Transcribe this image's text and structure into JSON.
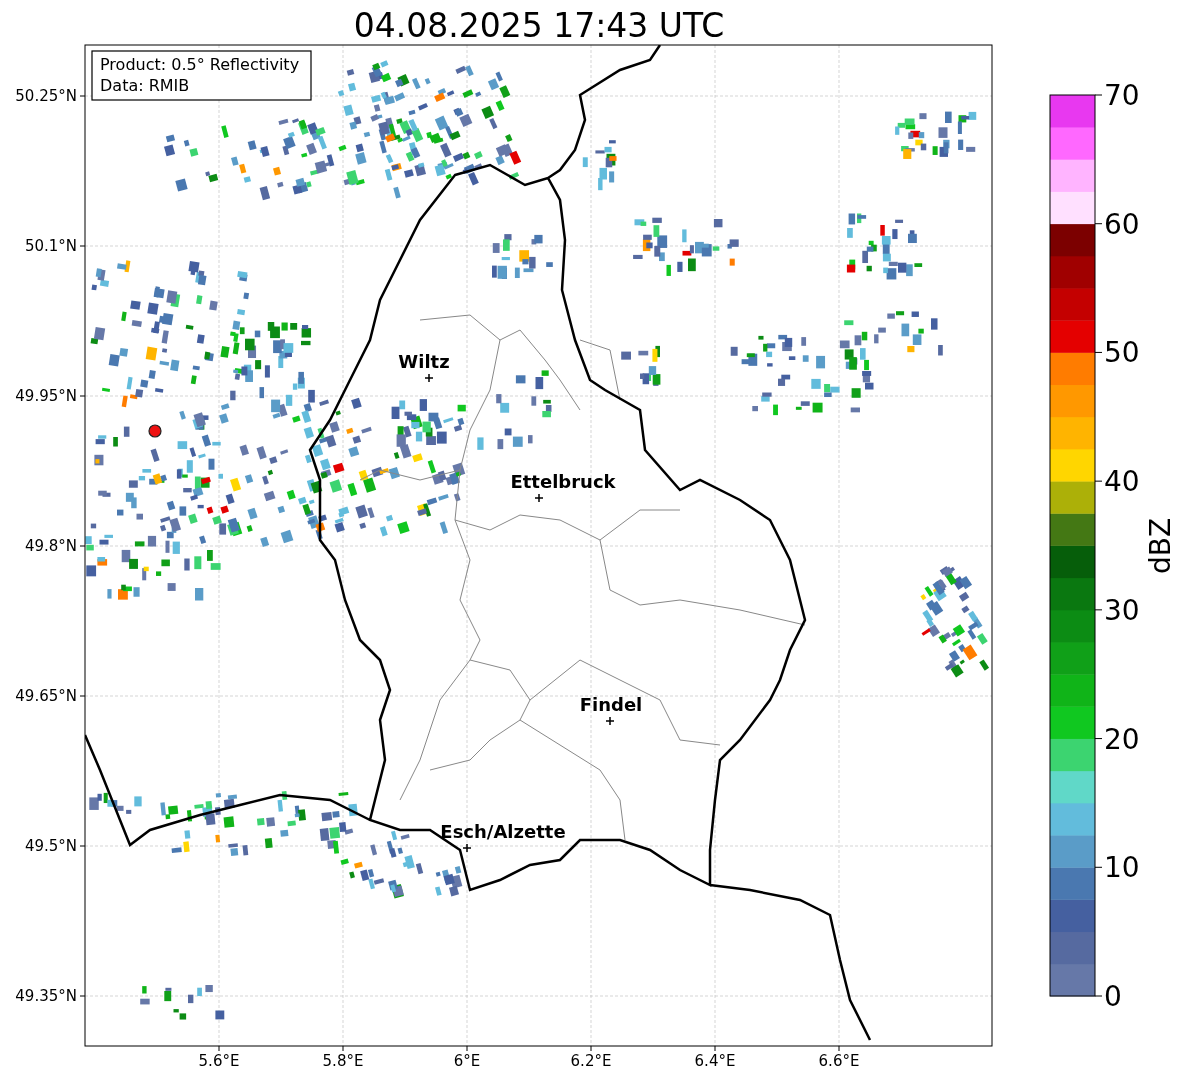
{
  "title": "04.08.2025 17:43 UTC",
  "info_box": {
    "lines": [
      "Product: 0.5° Reflectivity",
      "Data: RMIB"
    ]
  },
  "map": {
    "lat_ticks": [
      "50.25°N",
      "50.1°N",
      "49.95°N",
      "49.8°N",
      "49.65°N",
      "49.5°N",
      "49.35°N"
    ],
    "lon_ticks": [
      "5.6°E",
      "5.8°E",
      "6°E",
      "6.2°E",
      "6.4°E",
      "6.6°E"
    ],
    "cities": [
      {
        "name": "Wiltz"
      },
      {
        "name": "Ettelbruck"
      },
      {
        "name": "Findel"
      },
      {
        "name": "Esch/Alzette"
      }
    ]
  },
  "colorbar": {
    "label": "dBZ",
    "ticks": [
      "70",
      "60",
      "50",
      "40",
      "30",
      "20",
      "10",
      "0"
    ],
    "segments": [
      {
        "color": "#6678a8"
      },
      {
        "color": "#566aa0"
      },
      {
        "color": "#4560a0"
      },
      {
        "color": "#4a78b0"
      },
      {
        "color": "#5a9cc8"
      },
      {
        "color": "#62bcdc"
      },
      {
        "color": "#60d8c8"
      },
      {
        "color": "#3cd470"
      },
      {
        "color": "#10c820"
      },
      {
        "color": "#10b418"
      },
      {
        "color": "#10a018"
      },
      {
        "color": "#0c8c14"
      },
      {
        "color": "#0a7810"
      },
      {
        "color": "#065e0a"
      },
      {
        "color": "#447814"
      },
      {
        "color": "#acb008"
      },
      {
        "color": "#ffd600"
      },
      {
        "color": "#ffb400"
      },
      {
        "color": "#ff9800"
      },
      {
        "color": "#ff7c00"
      },
      {
        "color": "#e40000"
      },
      {
        "color": "#c40000"
      },
      {
        "color": "#a00000"
      },
      {
        "color": "#7c0000"
      },
      {
        "color": "#ffe0ff"
      },
      {
        "color": "#ffb4ff"
      },
      {
        "color": "#ff68ff"
      },
      {
        "color": "#e838f0"
      }
    ]
  }
}
